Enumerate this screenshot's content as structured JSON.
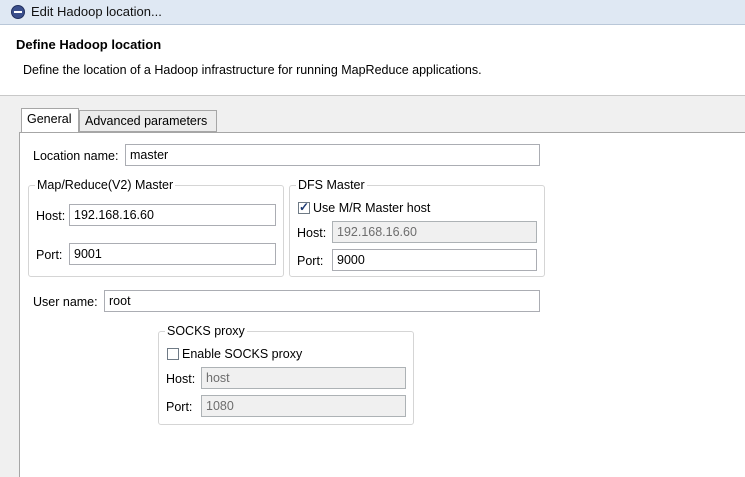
{
  "window": {
    "title": "Edit Hadoop location..."
  },
  "header": {
    "title": "Define Hadoop location",
    "description": "Define the location of a Hadoop infrastructure for running MapReduce applications."
  },
  "tabs": [
    {
      "label": "General",
      "active": true
    },
    {
      "label": "Advanced parameters",
      "active": false
    }
  ],
  "general": {
    "location_name_label": "Location name:",
    "location_name_value": "master",
    "mr_master": {
      "legend": "Map/Reduce(V2) Master",
      "host_label": "Host:",
      "host_value": "192.168.16.60",
      "port_label": "Port:",
      "port_value": "9001"
    },
    "dfs_master": {
      "legend": "DFS Master",
      "use_mr_host_label": "Use M/R Master host",
      "use_mr_host_checked": true,
      "host_label": "Host:",
      "host_value": "192.168.16.60",
      "port_label": "Port:",
      "port_value": "9000"
    },
    "user_name_label": "User name:",
    "user_name_value": "root",
    "socks_proxy": {
      "legend": "SOCKS proxy",
      "enable_label": "Enable SOCKS proxy",
      "enable_checked": false,
      "host_label": "Host:",
      "host_value": "host",
      "port_label": "Port:",
      "port_value": "1080"
    }
  }
}
